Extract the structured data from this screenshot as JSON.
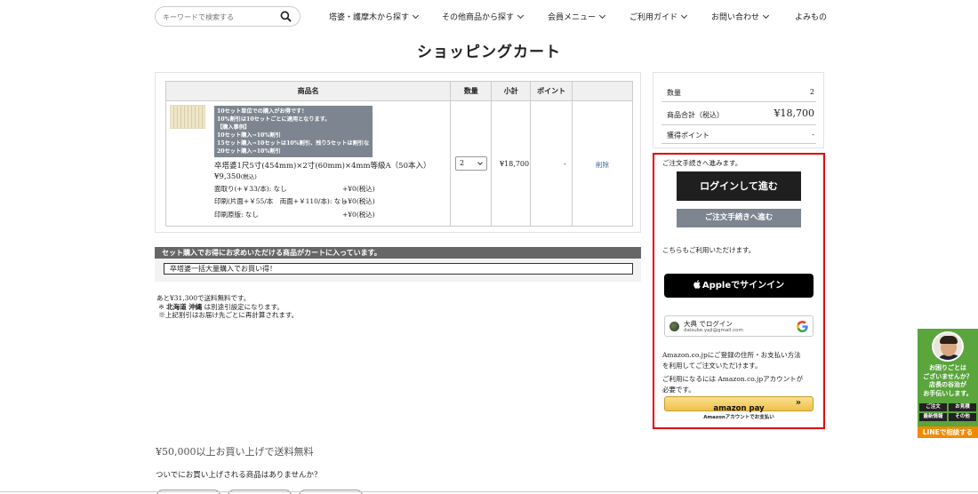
{
  "header": {
    "search_placeholder": "キーワードで検索する",
    "nav": [
      {
        "label": "塔婆・護摩木から探す"
      },
      {
        "label": "その他商品から探す"
      },
      {
        "label": "会員メニュー"
      },
      {
        "label": "ご利用ガイド"
      },
      {
        "label": "お問い合わせ"
      },
      {
        "label": "よみもの"
      }
    ]
  },
  "page_title": "ショッピングカート",
  "cart": {
    "columns": [
      "商品名",
      "数量",
      "小計",
      "ポイント",
      ""
    ],
    "item": {
      "banner_lines": [
        "10セット単位での購入がお得です！",
        "10%割引は10セットごとに適用となります。",
        "【購入事例】",
        "10セット購入→10%割引",
        "15セット購入→10セットは10%割引、残り5セットは割引なし",
        "20セット購入→10%割引"
      ],
      "name": "卒塔婆1尺5寸(454mm)×2寸(60mm)×4mm等級A（50本入）",
      "price": "¥9,350",
      "price_tax": "(税込)",
      "options": [
        {
          "label": "面取り(+￥33/本): なし",
          "value": "+¥0(税込)"
        },
        {
          "label": "印刷(片面+￥55/本　両面+￥110/本): なし",
          "value": "+¥0(税込)"
        },
        {
          "label": "印刷原版: なし",
          "value": "+¥0(税込)"
        }
      ],
      "quantity": "2",
      "subtotal": "¥18,700",
      "points": "-",
      "delete_label": "削除"
    }
  },
  "set_offer": {
    "heading": "セット購入でお得にお求めいただける商品がカートに入っています。",
    "link": "卒塔婆一括大量購入でお買い得！"
  },
  "notes": {
    "line1": "あと¥31,300で送料無料です。",
    "line2_prefix": "※",
    "line2_bold": "北海道 沖縄",
    "line2_rest": "は別途引設定になります。",
    "line3": "※上記割引はお届け先ごとに再計算されます。"
  },
  "free_shipping": "¥50,000以上お買い上げで送料無料",
  "suggest_heading": "ついでにお買い上げされる商品はありませんか？",
  "summary": {
    "qty_label": "数量",
    "qty_value": "2",
    "total_label": "商品合計（税込）",
    "total_value": "¥18,700",
    "points_label": "獲得ポイント",
    "points_value": "-"
  },
  "checkout": {
    "intro": "ご注文手続きへ進みます。",
    "login_button": "ログインして進む",
    "proceed_button": "ご注文手続きへ進む",
    "also_available": "こちらもご利用いただけます。",
    "apple_button": "Appleでサインイン",
    "google_name": "大典 でログイン",
    "google_email": "daisuke.yaji@gmail.com",
    "amazon_text1": "Amazon.co.jpにご登録の住所・お支払い方法",
    "amazon_text2": "を利用してご注文いただけます。",
    "amazon_text3": "ご利用になるには Amazon.co.jpアカウントが",
    "amazon_text4": "必要です。",
    "amazon_button": "amazon pay",
    "amazon_sub": "Amazonアカウントでお支払い"
  },
  "line_widget": {
    "line1": "お困りごとは",
    "line2": "ございませんか？",
    "line3": "店長の谷治が",
    "line4": "お手伝いします。",
    "cells": [
      "ご注文",
      "お見積",
      "最新情報",
      "その他"
    ],
    "bottom": "LINEで相談する"
  },
  "colors": {
    "highlight_border": "#e00000",
    "login_button": "#1f1f1f",
    "proceed_button": "#7d8590",
    "line_green": "#5aa53c",
    "line_orange": "#f08a00"
  }
}
